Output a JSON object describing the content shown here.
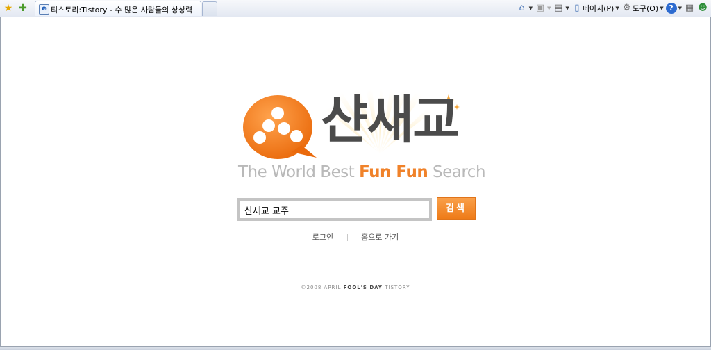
{
  "browser": {
    "tab_title": "티스토리:Tistory - 수 많은 사람들의 상상력",
    "tools": {
      "page_label": "페이지(P)",
      "tools_label": "도구(O)"
    },
    "icons": {
      "favorites": "star-icon",
      "add_favorites": "star-plus-icon",
      "home": "home-icon",
      "feeds": "rss-icon",
      "print": "printer-icon",
      "page": "page-icon",
      "tools": "gear-icon",
      "help": "help-icon",
      "research": "research-icon",
      "messenger": "messenger-icon"
    }
  },
  "logo": {
    "brand": "샨새교",
    "slogan_prefix": "The World Best ",
    "slogan_highlight": "Fun Fun",
    "slogan_suffix": " Search",
    "brand_color": "#4b4b4b",
    "accent_color": "#f0822a"
  },
  "search": {
    "value": "샨새교 교주",
    "button_label": "검색"
  },
  "links": {
    "login": "로그인",
    "home": "홈으로 가기"
  },
  "footer": {
    "prefix": "©2008 APRIL ",
    "bold": "FOOL'S DAY",
    "suffix": " TISTORY"
  }
}
